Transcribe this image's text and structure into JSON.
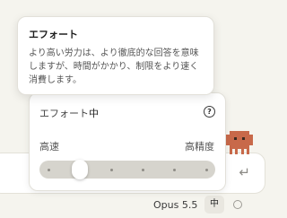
{
  "tooltip": {
    "title": "エフォート",
    "body": "より高い労力は、より徹底的な回答を意味しますが、時間がかかり、制限をより速く消費します。"
  },
  "effort_panel": {
    "title": "エフォート",
    "current_value": "中",
    "slider": {
      "low_label": "高速",
      "high_label": "高精度",
      "step_count": 6,
      "selected_step": 2
    }
  },
  "composer": {
    "send_icon": "return-arrow-icon"
  },
  "bottom_bar": {
    "model_name": "Opus 5.5",
    "effort_chip": "中"
  },
  "colors": {
    "mascot": "#c8694a",
    "slider_track": "#d6d4cd"
  }
}
